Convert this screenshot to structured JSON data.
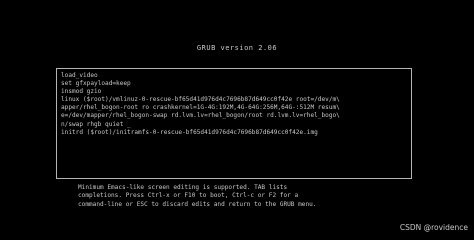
{
  "header": {
    "title": "GRUB version 2.06"
  },
  "editor": {
    "lines": [
      "load_video",
      "set gfxpayload=keep",
      "insmod gzio",
      "linux ($root)/vmlinuz-0-rescue-bf65d41d976d4c7696b87d649cc0f42e root=/dev/m\\",
      "apper/rhel_bogon-root ro crashkernel=1G-4G:192M,4G-64G:256M,64G-:512M resum\\",
      "e=/dev/mapper/rhel_bogon-swap rd.lvm.lv=rhel_bogon/root rd.lvm.lv=rhel_bogo\\",
      "n/swap rhgb quiet _",
      "initrd ($root)/initramfs-0-rescue-bf65d41d976d4c7696b87d649cc0f42e.img"
    ]
  },
  "help": {
    "lines": [
      "Minimum Emacs-like screen editing is supported. TAB lists",
      "completions. Press Ctrl-x or F10 to boot, Ctrl-c or F2 for a",
      "command-line or ESC to discard edits and return to the GRUB menu."
    ]
  },
  "watermark": {
    "text": "CSDN @rovidence"
  }
}
